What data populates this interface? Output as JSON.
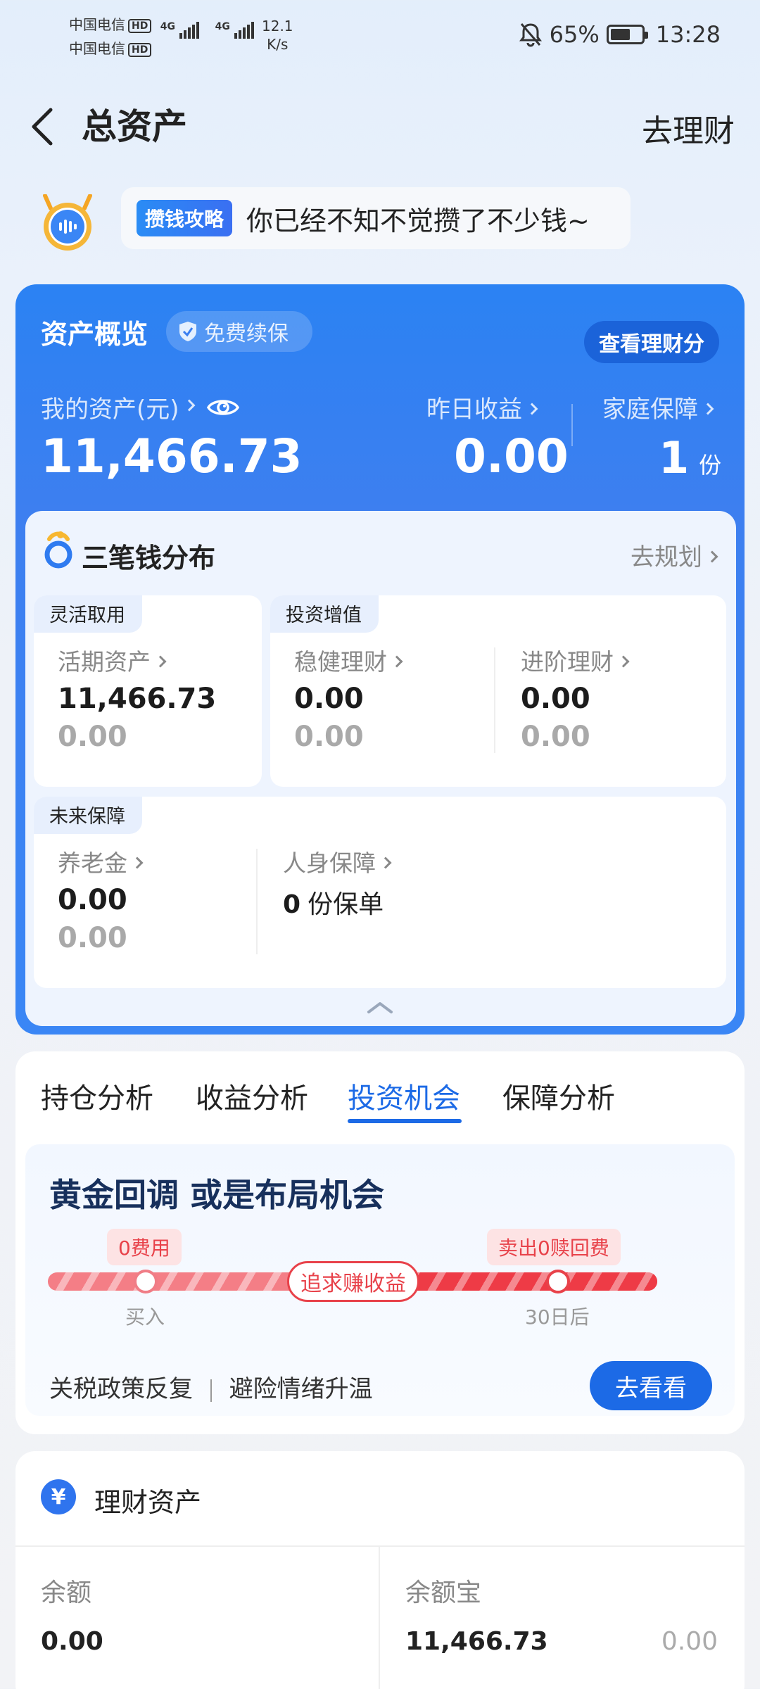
{
  "status_bar": {
    "carrier1": "中国电信",
    "carrier2": "中国电信",
    "hd": "HD",
    "net1": "4G",
    "net2": "4G",
    "speed_value": "12.1",
    "speed_unit": "K/s",
    "battery": "65%",
    "battery_level": 0.65,
    "time": "13:28"
  },
  "header": {
    "title": "总资产",
    "action": "去理财"
  },
  "tip": {
    "tag": "攒钱攻略",
    "text": "你已经不知不觉攒了不少钱~"
  },
  "overview": {
    "title": "资产概览",
    "badge": "免费续保",
    "score_button": "查看理财分",
    "my_assets_label": "我的资产(元)",
    "my_assets_value": "11,466.73",
    "yesterday_label": "昨日收益",
    "yesterday_value": "0.00",
    "family_label": "家庭保障",
    "family_value": "1",
    "family_unit": "份"
  },
  "three_money": {
    "title": "三笔钱分布",
    "link": "去规划",
    "flexible": {
      "tag": "灵活取用",
      "label": "活期资产",
      "value": "11,466.73",
      "sub_value": "0.00"
    },
    "invest": {
      "tag": "投资增值",
      "steady_label": "稳健理财",
      "steady_value": "0.00",
      "steady_sub": "0.00",
      "advanced_label": "进阶理财",
      "advanced_value": "0.00",
      "advanced_sub": "0.00"
    },
    "future": {
      "tag": "未来保障",
      "pension_label": "养老金",
      "pension_value": "0.00",
      "pension_sub": "0.00",
      "life_label": "人身保障",
      "life_value": "0",
      "life_unit": "份保单"
    }
  },
  "analysis": {
    "tabs": [
      "持仓分析",
      "收益分析",
      "投资机会",
      "保障分析"
    ],
    "active_tab": 2,
    "headline": "黄金回调 或是布局机会",
    "left_pill": "0费用",
    "right_pill": "卖出0赎回费",
    "center_pill": "追求赚收益",
    "left_point": "买入",
    "right_point": "30日后",
    "news_a": "关税政策反复",
    "news_b": "避险情绪升温",
    "button": "去看看"
  },
  "finance_assets": {
    "title": "理财资产",
    "yen_symbol": "¥",
    "balance_label": "余额",
    "balance_value": "0.00",
    "yuebao_label": "余额宝",
    "yuebao_value": "11,466.73",
    "yuebao_income": "0.00"
  },
  "colors": {
    "primary_blue": "#1c6ae6",
    "card_blue": "#2b82f3",
    "accent_red": "#e8424a"
  }
}
